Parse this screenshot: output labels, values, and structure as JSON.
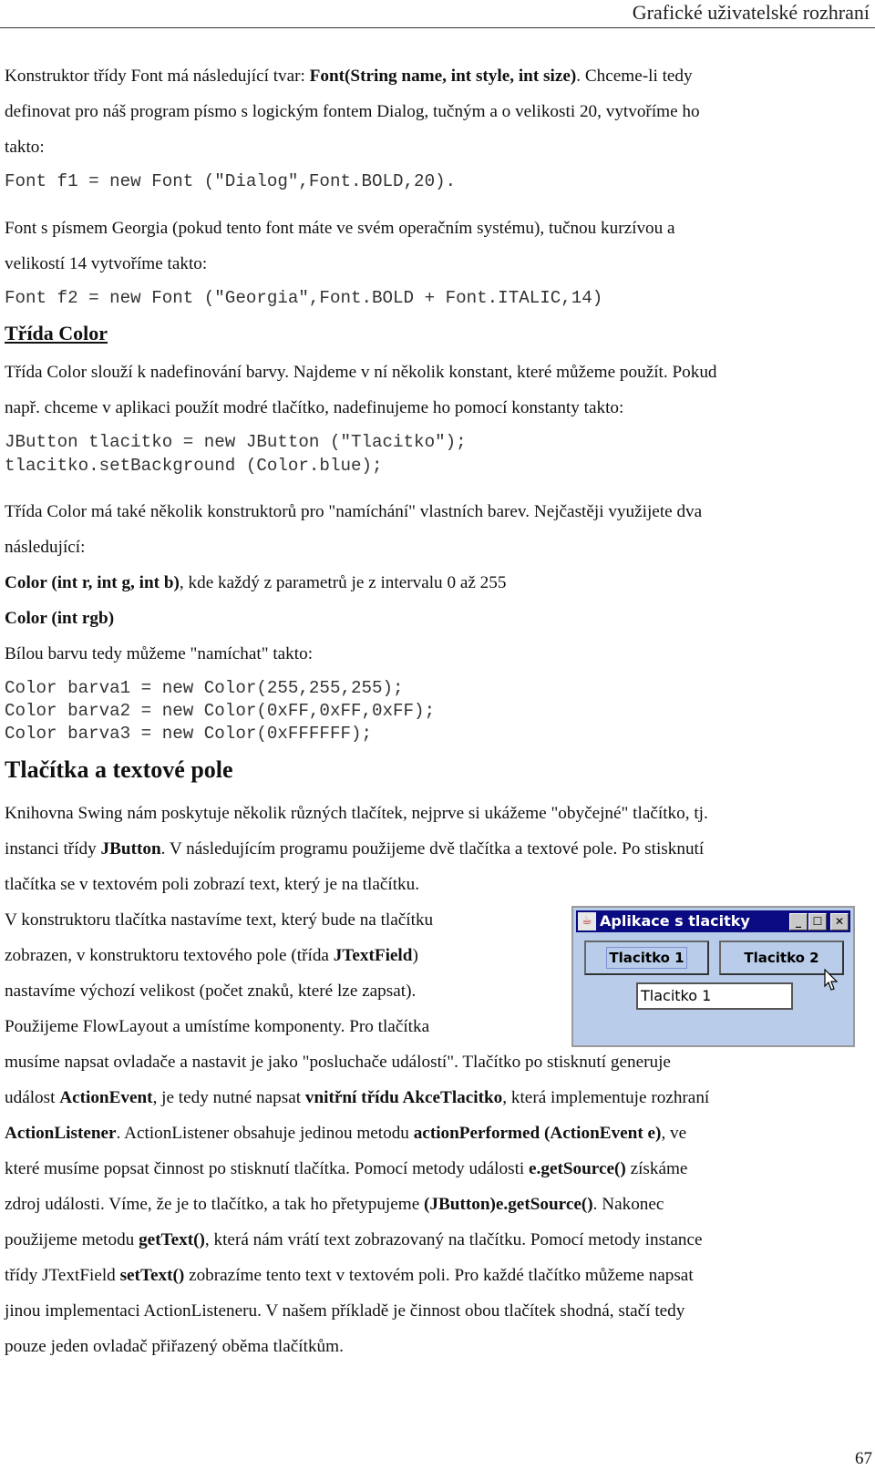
{
  "header": {
    "title": "Grafické uživatelské rozhraní"
  },
  "paragraphs": {
    "p1_line1_a": "Konstruktor třídy Font má následující tvar: ",
    "p1_line1_b": "Font(String name, int style, int size)",
    "p1_line1_c": ". Chceme-li tedy",
    "p1_line2": "definovat pro náš program písmo s logickým fontem Dialog, tučným a o velikosti 20, vytvoříme ho",
    "p1_line3": "takto:",
    "code1": "Font f1 = new Font (\"Dialog\",Font.BOLD,20).",
    "p2_line1": "Font s písmem Georgia (pokud tento font máte ve svém operačním systému), tučnou kurzívou a",
    "p2_line2": "velikostí 14 vytvoříme takto:",
    "code2": "Font f2 = new Font (\"Georgia\",Font.BOLD + Font.ITALIC,14)",
    "heading_color": "Třída Color",
    "p3_line1": "Třída Color slouží k nadefinování barvy. Najdeme v ní několik konstant, které můžeme použít. Pokud",
    "p3_line2": "např. chceme v aplikaci použít modré tlačítko, nadefinujeme ho pomocí konstanty takto:",
    "code3_line1": "JButton tlacitko = new JButton (\"Tlacitko\");",
    "code3_line2": "tlacitko.setBackground (Color.blue);",
    "p4_line1": "Třída Color má také několik konstruktorů pro \"namíchání\" vlastních barev. Nejčastěji využijete dva",
    "p4_line2": "následující:",
    "p5_bold": "Color (int r, int g, int b)",
    "p5_rest": ", kde každý z parametrů je z intervalu 0 až 255",
    "p6_bold": "Color (int rgb)",
    "p7": "Bílou barvu tedy můžeme \"namíchat\" takto:",
    "code4_line1": "Color barva1 = new Color(255,255,255);",
    "code4_line2": "Color barva2 = new Color(0xFF,0xFF,0xFF);",
    "code4_line3": "Color barva3 = new Color(0xFFFFFF);",
    "heading_buttons": "Tlačítka a textové pole",
    "p8_line1": "Knihovna Swing nám poskytuje několik různých tlačítek, nejprve si ukážeme \"obyčejné\" tlačítko, tj.",
    "p8_line2_a": "instanci třídy ",
    "p8_line2_b": "JButton",
    "p8_line2_c": ". V následujícím programu použijeme dvě tlačítka a textové pole. Po stisknutí",
    "p8_line3": "tlačítka se v textovém poli zobrazí text, který je na tlačítku.",
    "p9_line1": "V konstruktoru tlačítka nastavíme text, který bude na tlačítku",
    "p9_line2_a": "zobrazen, v konstruktoru textového pole (třída ",
    "p9_line2_b": "JTextField",
    "p9_line2_c": ")",
    "p9_line3": "nastavíme výchozí velikost (počet znaků, které lze zapsat).",
    "p9_line4": "Použijeme FlowLayout a umístíme komponenty. Pro tlačítka",
    "p9_line5": "musíme napsat ovladače a nastavit je jako \"posluchače událostí\". Tlačítko po stisknutí generuje",
    "p9_line6_a": "událost ",
    "p9_line6_b": "ActionEvent",
    "p9_line6_c": ", je tedy nutné napsat ",
    "p9_line6_d": "vnitřní třídu AkceTlacitko",
    "p9_line6_e": ", která implementuje rozhraní",
    "p9_line7_a": "ActionListener",
    "p9_line7_b": ". ActionListener obsahuje jedinou metodu ",
    "p9_line7_c": "actionPerformed (ActionEvent e)",
    "p9_line7_d": ", ve",
    "p9_line8_a": "které musíme popsat činnost po stisknutí tlačítka. Pomocí metody události ",
    "p9_line8_b": "e.getSource()",
    "p9_line8_c": " získáme",
    "p9_line9_a": "zdroj události. Víme, že je to tlačítko, a tak ho přetypujeme ",
    "p9_line9_b": "(JButton)e.getSource()",
    "p9_line9_c": ". Nakonec",
    "p9_line10_a": "použijeme metodu ",
    "p9_line10_b": "getText()",
    "p9_line10_c": ", která nám vrátí text zobrazovaný na tlačítku. Pomocí metody instance",
    "p9_line11_a": "třídy JTextField ",
    "p9_line11_b": "setText()",
    "p9_line11_c": " zobrazíme tento text v textovém poli. Pro každé tlačítko můžeme napsat",
    "p9_line12": "jinou implementaci ActionListeneru. V našem příkladě je činnost obou tlačítek shodná, stačí tedy",
    "p9_line13": "pouze jeden ovladač přiřazený oběma tlačítkům."
  },
  "screenshot_window": {
    "title": "Aplikace s tlacitky",
    "button1": "Tlacitko 1",
    "button2": "Tlacitko 2",
    "textfield_value": "Tlacitko 1",
    "minimize_glyph": "_",
    "maximize_glyph": "☐",
    "close_glyph": "✕",
    "colors": {
      "title_bar": "#0a0a82",
      "panel": "#b9cdea"
    }
  },
  "footer": {
    "page_number": "67"
  }
}
